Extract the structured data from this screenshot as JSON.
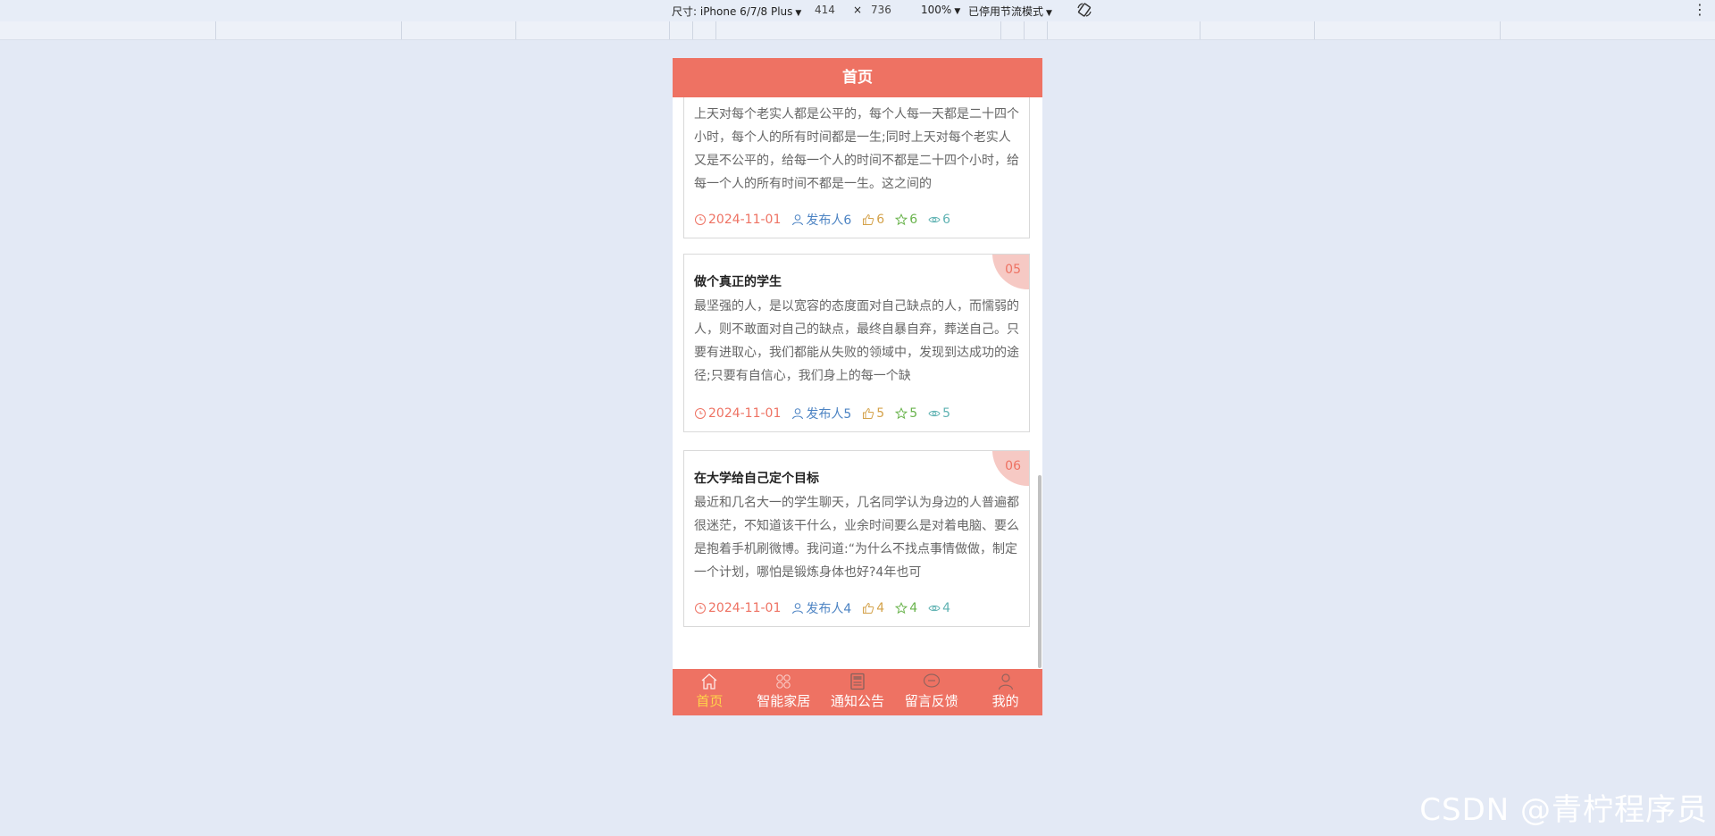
{
  "devtools": {
    "size_label": "尺寸: iPhone 6/7/8 Plus",
    "width": "414",
    "times": "×",
    "height": "736",
    "zoom": "100%",
    "throttle": "已停用节流模式"
  },
  "header": {
    "title": "首页"
  },
  "articles": [
    {
      "badge": "",
      "title": "",
      "desc": "上天对每个老实人都是公平的，每个人每一天都是二十四个小时，每个人的所有时间都是一生;同时上天对每个老实人又是不公平的，给每一个人的时间不都是二十四个小时，给每一个人的所有时间不都是一生。这之间的",
      "date": "2024-11-01",
      "author": "发布人6",
      "likes": "6",
      "favorites": "6",
      "views": "6"
    },
    {
      "badge": "05",
      "title": "做个真正的学生",
      "desc": "最坚强的人，是以宽容的态度面对自己缺点的人，而懦弱的人，则不敢面对自己的缺点，最终自暴自弃，葬送自己。只要有进取心，我们都能从失败的领域中，发现到达成功的途径;只要有自信心，我们身上的每一个缺",
      "date": "2024-11-01",
      "author": "发布人5",
      "likes": "5",
      "favorites": "5",
      "views": "5"
    },
    {
      "badge": "06",
      "title": "在大学给自己定个目标",
      "desc": "最近和几名大一的学生聊天，几名同学认为身边的人普遍都很迷茫，不知道该干什么，业余时间要么是对着电脑、要么是抱着手机刷微博。我问道:“为什么不找点事情做做，制定一个计划，哪怕是锻炼身体也好?4年也可",
      "date": "2024-11-01",
      "author": "发布人4",
      "likes": "4",
      "favorites": "4",
      "views": "4"
    }
  ],
  "tabbar": [
    {
      "label": "首页",
      "icon": "home-icon",
      "active": true
    },
    {
      "label": "智能家居",
      "icon": "grid-icon",
      "active": false
    },
    {
      "label": "通知公告",
      "icon": "document-icon",
      "active": false
    },
    {
      "label": "留言反馈",
      "icon": "message-icon",
      "active": false
    },
    {
      "label": "我的",
      "icon": "user-icon",
      "active": false
    }
  ],
  "watermark": "CSDN @青柠程序员",
  "colors": {
    "accent": "#ee7263",
    "active_tab": "#ffd54a",
    "date": "#ee7263",
    "author": "#4c83c3",
    "likes": "#d4a24a",
    "favorites": "#69b34c",
    "views": "#5fb2b2"
  }
}
